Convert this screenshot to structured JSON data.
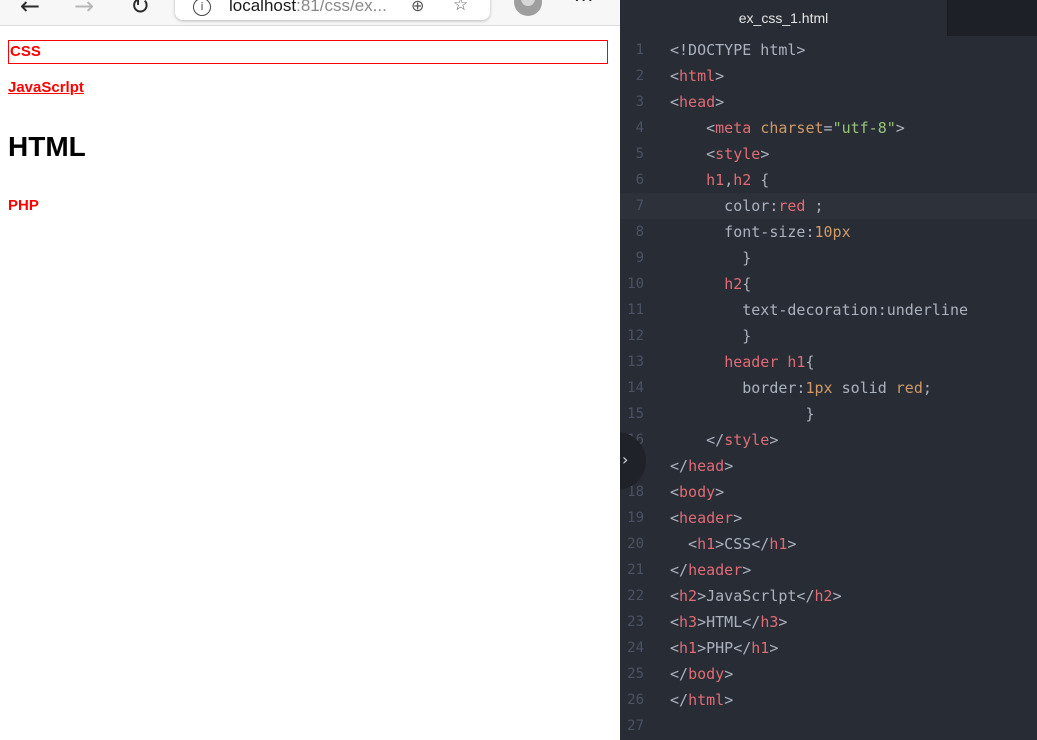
{
  "browser": {
    "nav": {
      "back_icon": "←",
      "forward_icon": "→",
      "reload_icon": "↻"
    },
    "address": {
      "info_icon": "i",
      "host": "localhost",
      "path": ":81/css/ex...",
      "zoom_icon": "⊕",
      "favorites_icon": "☆"
    },
    "more_icon": "···",
    "page": {
      "h1_css": "CSS",
      "h2_js": "JavaScrlpt",
      "h3_html": "HTML",
      "h1_php": "PHP"
    }
  },
  "editor": {
    "tab_title": "ex_css_1.html",
    "fold_icon": "›",
    "current_line": 7,
    "lines": [
      {
        "n": "1",
        "parts": [
          [
            "p",
            "<!DOCTYPE html>"
          ]
        ]
      },
      {
        "n": "2",
        "parts": [
          [
            "p",
            "<"
          ],
          [
            "t",
            "html"
          ],
          [
            "p",
            ">"
          ]
        ]
      },
      {
        "n": "3",
        "parts": [
          [
            "p",
            "<"
          ],
          [
            "t",
            "head"
          ],
          [
            "p",
            ">"
          ]
        ]
      },
      {
        "n": "4",
        "parts": [
          [
            "p",
            "    <"
          ],
          [
            "t",
            "meta"
          ],
          [
            "p",
            " "
          ],
          [
            "a",
            "charset"
          ],
          [
            "p",
            "="
          ],
          [
            "s",
            "\"utf-8\""
          ],
          [
            "p",
            ">"
          ]
        ]
      },
      {
        "n": "5",
        "parts": [
          [
            "p",
            "    <"
          ],
          [
            "t",
            "style"
          ],
          [
            "p",
            ">"
          ]
        ]
      },
      {
        "n": "6",
        "parts": [
          [
            "p",
            "    "
          ],
          [
            "t",
            "h1"
          ],
          [
            "p",
            ","
          ],
          [
            "t",
            "h2"
          ],
          [
            "p",
            " {"
          ]
        ]
      },
      {
        "n": "7",
        "parts": [
          [
            "p",
            "      color:"
          ],
          [
            "t",
            "red"
          ],
          [
            "p",
            " ;"
          ]
        ]
      },
      {
        "n": "8",
        "parts": [
          [
            "p",
            "      font-size:"
          ],
          [
            "a",
            "10px"
          ]
        ]
      },
      {
        "n": "9",
        "parts": [
          [
            "p",
            "        }"
          ]
        ]
      },
      {
        "n": "10",
        "parts": [
          [
            "p",
            "      "
          ],
          [
            "t",
            "h2"
          ],
          [
            "p",
            "{"
          ]
        ]
      },
      {
        "n": "11",
        "parts": [
          [
            "p",
            "        text-decoration:underline"
          ]
        ]
      },
      {
        "n": "12",
        "parts": [
          [
            "p",
            "        }"
          ]
        ]
      },
      {
        "n": "13",
        "parts": [
          [
            "p",
            "      "
          ],
          [
            "t",
            "header h1"
          ],
          [
            "p",
            "{"
          ]
        ]
      },
      {
        "n": "14",
        "parts": [
          [
            "p",
            "        border:"
          ],
          [
            "a",
            "1px"
          ],
          [
            "p",
            " solid "
          ],
          [
            "a",
            "red"
          ],
          [
            "p",
            ";"
          ]
        ]
      },
      {
        "n": "15",
        "parts": [
          [
            "p",
            "               }"
          ]
        ]
      },
      {
        "n": "16",
        "parts": [
          [
            "p",
            "    </"
          ],
          [
            "t",
            "style"
          ],
          [
            "p",
            ">"
          ]
        ]
      },
      {
        "n": "17",
        "parts": [
          [
            "p",
            "</"
          ],
          [
            "t",
            "head"
          ],
          [
            "p",
            ">"
          ]
        ]
      },
      {
        "n": "18",
        "parts": [
          [
            "p",
            "<"
          ],
          [
            "t",
            "body"
          ],
          [
            "p",
            ">"
          ]
        ]
      },
      {
        "n": "19",
        "parts": [
          [
            "p",
            "<"
          ],
          [
            "t",
            "header"
          ],
          [
            "p",
            ">"
          ]
        ]
      },
      {
        "n": "20",
        "parts": [
          [
            "p",
            "  <"
          ],
          [
            "t",
            "h1"
          ],
          [
            "p",
            ">CSS</"
          ],
          [
            "t",
            "h1"
          ],
          [
            "p",
            ">"
          ]
        ]
      },
      {
        "n": "21",
        "parts": [
          [
            "p",
            "</"
          ],
          [
            "t",
            "header"
          ],
          [
            "p",
            ">"
          ]
        ]
      },
      {
        "n": "22",
        "parts": [
          [
            "p",
            "<"
          ],
          [
            "t",
            "h2"
          ],
          [
            "p",
            ">JavaScrlpt</"
          ],
          [
            "t",
            "h2"
          ],
          [
            "p",
            ">"
          ]
        ]
      },
      {
        "n": "23",
        "parts": [
          [
            "p",
            "<"
          ],
          [
            "t",
            "h3"
          ],
          [
            "p",
            ">HTML</"
          ],
          [
            "t",
            "h3"
          ],
          [
            "p",
            ">"
          ]
        ]
      },
      {
        "n": "24",
        "parts": [
          [
            "p",
            "<"
          ],
          [
            "t",
            "h1"
          ],
          [
            "p",
            ">PHP</"
          ],
          [
            "t",
            "h1"
          ],
          [
            "p",
            ">"
          ]
        ]
      },
      {
        "n": "25",
        "parts": [
          [
            "p",
            "</"
          ],
          [
            "t",
            "body"
          ],
          [
            "p",
            ">"
          ]
        ]
      },
      {
        "n": "26",
        "parts": [
          [
            "p",
            "</"
          ],
          [
            "t",
            "html"
          ],
          [
            "p",
            ">"
          ]
        ]
      },
      {
        "n": "27",
        "parts": []
      }
    ]
  }
}
